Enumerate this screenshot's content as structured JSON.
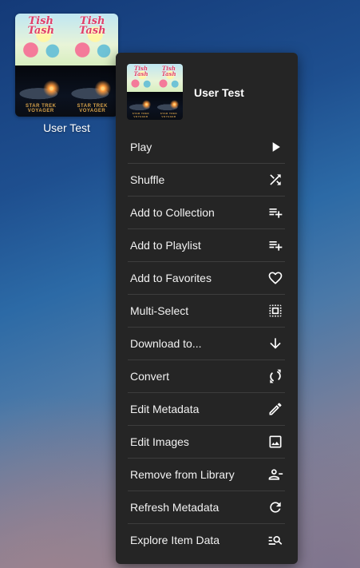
{
  "poster": {
    "kids_title": "Tish Tash",
    "space_title": "STAR TREK VOYAGER",
    "label": "User Test"
  },
  "menu": {
    "title": "User Test",
    "items": [
      {
        "label": "Play",
        "icon": "play-icon"
      },
      {
        "label": "Shuffle",
        "icon": "shuffle-icon"
      },
      {
        "label": "Add to Collection",
        "icon": "playlist-add-icon"
      },
      {
        "label": "Add to Playlist",
        "icon": "playlist-add-icon"
      },
      {
        "label": "Add to Favorites",
        "icon": "heart-icon"
      },
      {
        "label": "Multi-Select",
        "icon": "select-all-icon"
      },
      {
        "label": "Download to...",
        "icon": "arrow-down-icon"
      },
      {
        "label": "Convert",
        "icon": "convert-icon"
      },
      {
        "label": "Edit Metadata",
        "icon": "pencil-icon"
      },
      {
        "label": "Edit Images",
        "icon": "image-icon"
      },
      {
        "label": "Remove from Library",
        "icon": "person-remove-icon"
      },
      {
        "label": "Refresh Metadata",
        "icon": "refresh-icon"
      },
      {
        "label": "Explore Item Data",
        "icon": "manage-search-icon"
      }
    ]
  }
}
